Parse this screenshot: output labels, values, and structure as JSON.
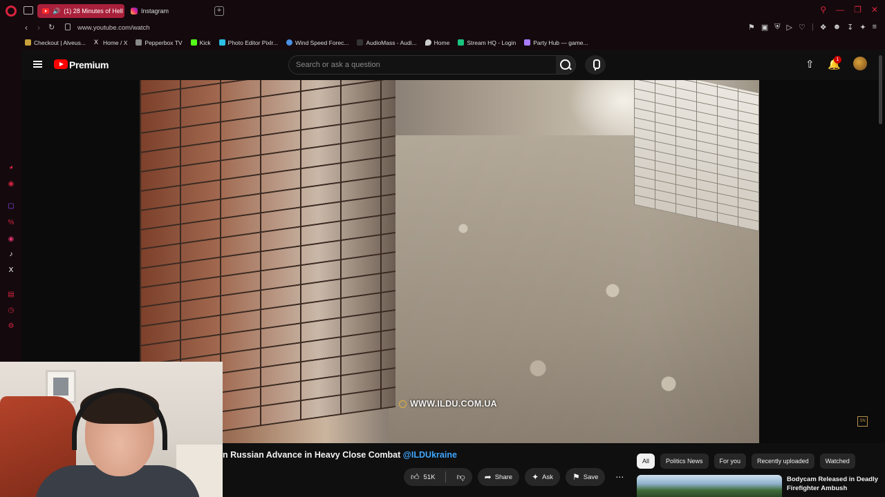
{
  "browser": {
    "tabs": [
      {
        "label": "(1) 28 Minutes of Hell -",
        "active": true
      },
      {
        "label": "Instagram",
        "active": false
      }
    ],
    "url": "www.youtube.com/watch",
    "bookmarks": [
      {
        "label": "Checkout | Alveus...",
        "color": "#c9a13a"
      },
      {
        "label": "Home / X",
        "color": "#ffffff"
      },
      {
        "label": "Pepperbox TV",
        "color": "#888888"
      },
      {
        "label": "Kick",
        "color": "#53fc18"
      },
      {
        "label": "Photo Editor Pixlr...",
        "color": "#2bc0e4"
      },
      {
        "label": "Wind Speed Forec...",
        "color": "#4a90e2"
      },
      {
        "label": "AudioMass - Audi...",
        "color": "#333333"
      },
      {
        "label": "Home",
        "color": "#cccccc"
      },
      {
        "label": "Stream HQ - Login",
        "color": "#19c37d"
      },
      {
        "label": "Party Hub — game...",
        "color": "#a97bff"
      }
    ]
  },
  "youtube": {
    "brand": "Premium",
    "search_placeholder": "Search or ask a question",
    "notification_count": "1",
    "video": {
      "watermark": "WWW.ILDU.COM.UA",
      "corner_logo": "SN",
      "title_text": "n Russian Advance in Heavy Close Combat ",
      "title_handle": "@ILDUkraine"
    },
    "actions": {
      "like_count": "51K",
      "share": "Share",
      "ask": "Ask",
      "save": "Save"
    },
    "chips": [
      "All",
      "Politics News",
      "For you",
      "Recently uploaded",
      "Watched"
    ],
    "recommendation": {
      "title": "Bodycam Released in Deadly Firefighter Ambush"
    }
  },
  "colors": {
    "accent": "#d8233f",
    "youtube_red": "#ff0000",
    "link_blue": "#3ea6ff"
  }
}
